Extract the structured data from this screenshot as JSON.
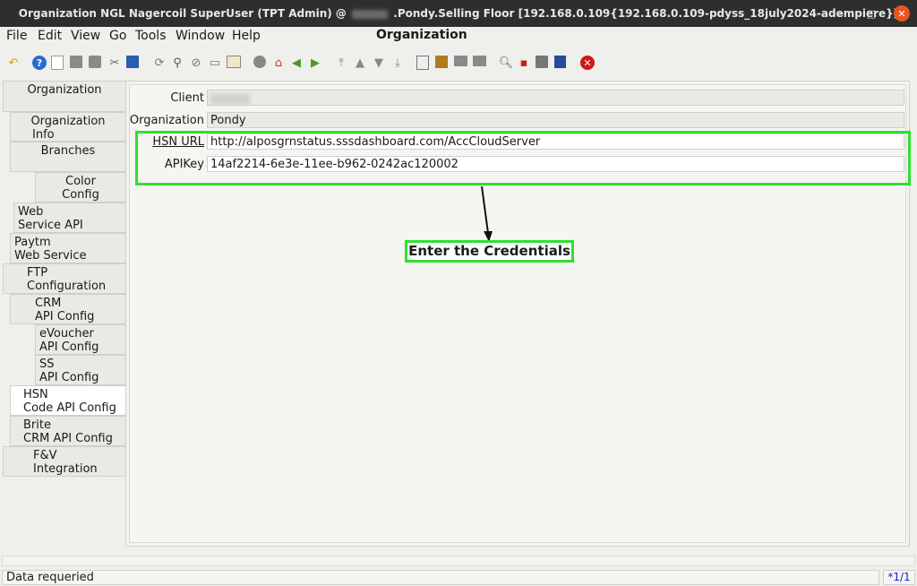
{
  "window": {
    "title_prefix": "Organization  NGL  Nagercoil  SuperUser (TPT Admin) @",
    "title_suffix": ".Pondy.Selling Floor [192.168.0.109{192.168.0.109-pdyss_18july2024-adempiere}]",
    "minimize": "–",
    "maximize": "□",
    "close": "✕"
  },
  "menu": {
    "file": "File",
    "edit": "Edit",
    "view": "View",
    "go": "Go",
    "tools": "Tools",
    "window": "Window",
    "help": "Help",
    "current_window": "Organization"
  },
  "toolbar": {
    "icons": [
      "undo-icon",
      "help-icon",
      "new-record-icon",
      "copy-record-icon",
      "delete-record-icon",
      "delete-selection-icon",
      "save-icon",
      "refresh-icon",
      "find-icon",
      "attachment-icon",
      "chat-icon",
      "multi-view-icon",
      "history-icon",
      "home-icon",
      "back-icon",
      "forward-icon",
      "first-record-icon",
      "previous-record-icon",
      "next-record-icon",
      "last-record-icon",
      "report-icon",
      "archive-icon",
      "print-preview-icon",
      "print-icon",
      "zoom-across-icon",
      "active-workflows-icon",
      "request-icon",
      "product-info-icon",
      "exit-icon"
    ]
  },
  "tabs": [
    {
      "label1": "Organization",
      "label2": ""
    },
    {
      "label1": "Organization",
      "label2": "Info"
    },
    {
      "label1": "Branches",
      "label2": ""
    },
    {
      "label1": "Color",
      "label2": "Config"
    },
    {
      "label1": "Web",
      "label2": "Service API Config"
    },
    {
      "label1": "Paytm",
      "label2": "Web Service Config"
    },
    {
      "label1": "FTP",
      "label2": "Configuration"
    },
    {
      "label1": "CRM",
      "label2": "API Config"
    },
    {
      "label1": "eVoucher",
      "label2": "API Config"
    },
    {
      "label1": "SS",
      "label2": "API Config"
    },
    {
      "label1": "HSN",
      "label2": "Code API Config"
    },
    {
      "label1": "Brite",
      "label2": "CRM API Config"
    },
    {
      "label1": "F&V",
      "label2": "Integration"
    }
  ],
  "form": {
    "client_label": "Client",
    "organization_label": "Organization",
    "organization_value": "Pondy",
    "hsn_url_label": "HSN URL",
    "hsn_url_value": "http://alposgrnstatus.sssdashboard.com/AccCloudServer",
    "apikey_label": "APIKey",
    "apikey_value": "14af2214-6e3e-11ee-b962-0242ac120002"
  },
  "annotation": {
    "text": "Enter the Credentials",
    "color": "#2de12d"
  },
  "status": {
    "message": "Data requeried",
    "record": "*1/1"
  }
}
